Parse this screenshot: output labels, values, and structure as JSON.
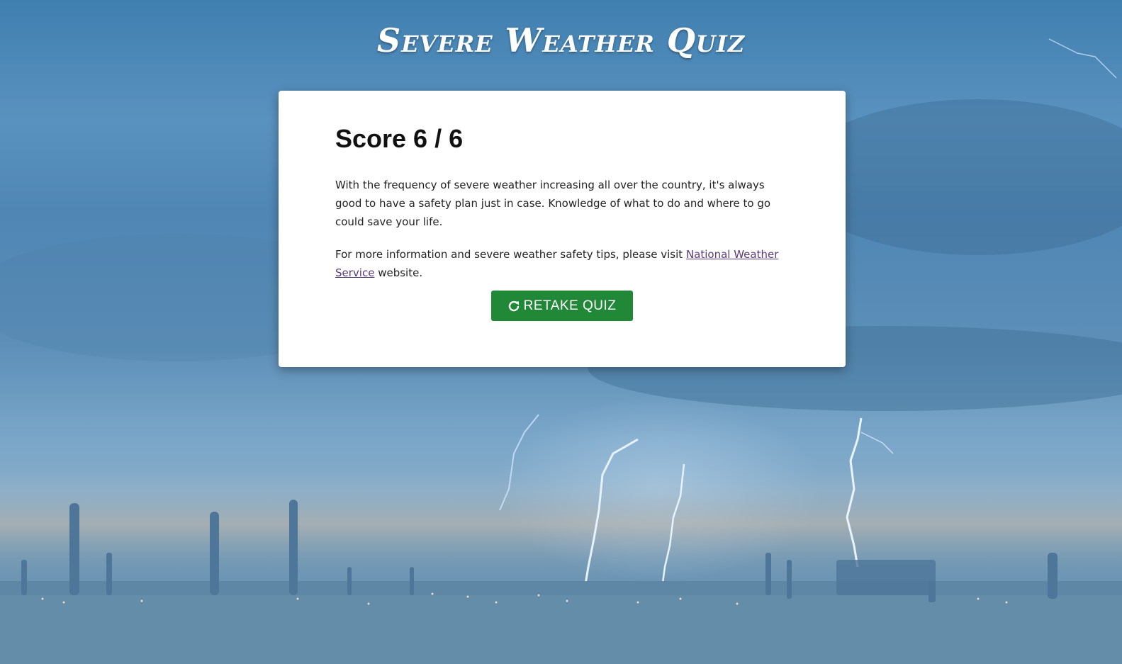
{
  "header": {
    "title": "Severe Weather Quiz"
  },
  "result": {
    "score_label": "Score 6 / 6",
    "paragraph_1": "With the frequency of severe weather increasing all over the country, it's always good to have a safety plan just in case. Knowledge of what to do and where to go could save your life.",
    "paragraph_2_prefix": "For more information and severe weather safety tips, please visit ",
    "link_text": "National Weather Service",
    "paragraph_2_suffix": " website.",
    "retake_icon": "redo-icon",
    "retake_label": "RETAKE QUIZ"
  },
  "colors": {
    "button": "#218838",
    "link": "#5b3a78",
    "card": "#ffffff",
    "sky": "#4f86b4"
  }
}
